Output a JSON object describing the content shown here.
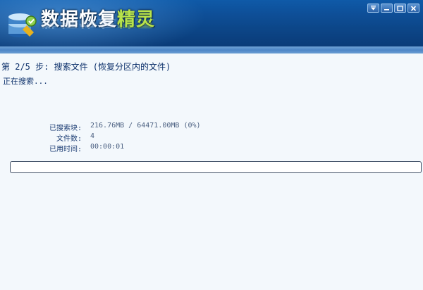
{
  "app": {
    "title_part1": "数据恢复",
    "title_part2": "精灵",
    "icon": "data-recovery-logo-icon"
  },
  "window_controls": {
    "icons": [
      "menu-dropdown-icon",
      "minimize-icon",
      "maximize-icon",
      "close-icon"
    ]
  },
  "main": {
    "step_title": "第 2/5 步: 搜索文件 (恢复分区内的文件)",
    "status": "正在搜索...",
    "stats": [
      {
        "label": "已搜索块:",
        "value": "216.76MB / 64471.00MB (0%)"
      },
      {
        "label": "文件数:",
        "value": "4"
      },
      {
        "label": "已用时间:",
        "value": "00:00:01"
      }
    ],
    "progress": 0
  },
  "colors": {
    "header_blue": "#0e4f98",
    "accent_green": "#b8e34a",
    "text_dark_blue": "#0b2f6a",
    "background": "#f3f8fc"
  }
}
